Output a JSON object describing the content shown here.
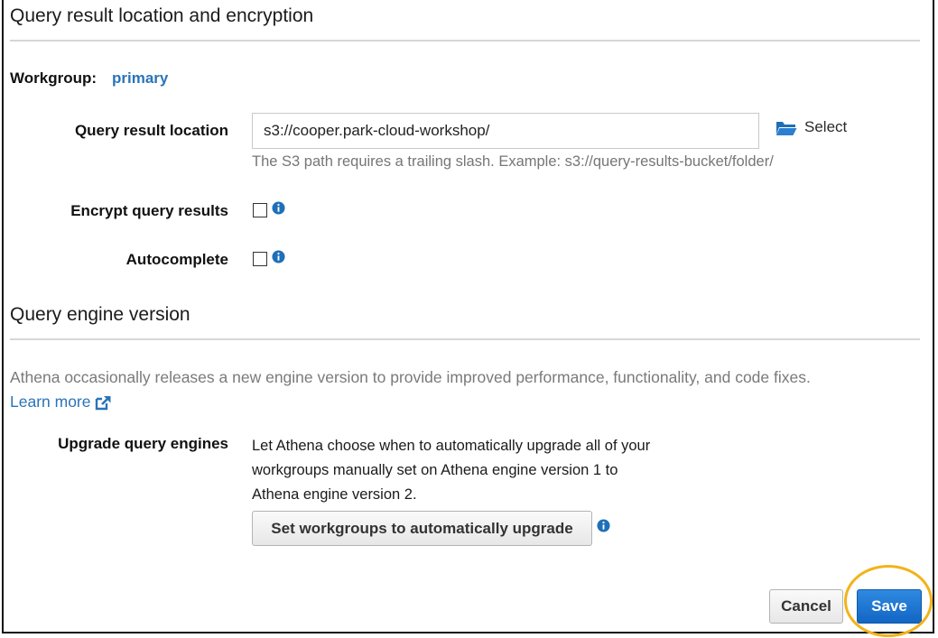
{
  "sections": {
    "query_result_title": "Query result location and encryption",
    "engine_title": "Query engine version"
  },
  "workgroup": {
    "label": "Workgroup:",
    "value": "primary"
  },
  "query_result": {
    "location_label": "Query result location",
    "location_value": "s3://cooper.park-cloud-workshop/",
    "select_label": "Select",
    "hint": "The S3 path requires a trailing slash. Example: s3://query-results-bucket/folder/",
    "encrypt_label": "Encrypt query results",
    "encrypt_checked": false,
    "autocomplete_label": "Autocomplete",
    "autocomplete_checked": false
  },
  "engine": {
    "description": "Athena occasionally releases a new engine version to provide improved performance, functionality, and code fixes.",
    "learn_more": "Learn more",
    "upgrade_label": "Upgrade query engines",
    "upgrade_text_lines": [
      "Let Athena choose when to automatically upgrade all of your",
      "workgroups manually set on Athena engine version 1 to",
      "Athena engine version 2."
    ],
    "upgrade_button": "Set workgroups to automatically upgrade"
  },
  "footer": {
    "cancel_label": "Cancel",
    "save_label": "Save"
  },
  "icons": {
    "folder": "folder-open-icon",
    "info": "info-icon",
    "external": "external-link-icon"
  },
  "colors": {
    "link": "#2a74b8",
    "primary_button": "#1a73cf",
    "highlight": "#f2b31a",
    "info": "#1f6fb8"
  }
}
